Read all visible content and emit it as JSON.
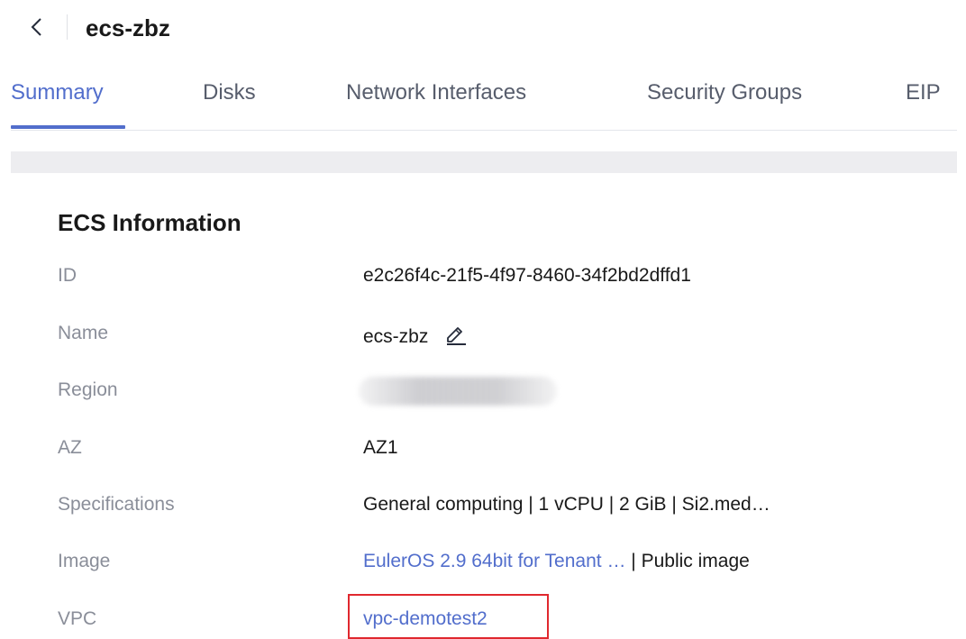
{
  "header": {
    "title": "ecs-zbz"
  },
  "tabs": [
    {
      "label": "Summary",
      "active": true
    },
    {
      "label": "Disks",
      "active": false
    },
    {
      "label": "Network Interfaces",
      "active": false
    },
    {
      "label": "Security Groups",
      "active": false
    },
    {
      "label": "EIP",
      "active": false
    }
  ],
  "section": {
    "title": "ECS Information"
  },
  "info": {
    "id": {
      "label": "ID",
      "value": "e2c26f4c-21f5-4f97-8460-34f2bd2dffd1"
    },
    "name": {
      "label": "Name",
      "value": "ecs-zbz"
    },
    "region": {
      "label": "Region",
      "value_redacted": true
    },
    "az": {
      "label": "AZ",
      "value": "AZ1"
    },
    "specifications": {
      "label": "Specifications",
      "value": "General computing | 1 vCPU | 2 GiB | Si2.med…"
    },
    "image": {
      "label": "Image",
      "link": "EulerOS 2.9 64bit for Tenant …",
      "suffix": " | Public image"
    },
    "vpc": {
      "label": "VPC",
      "link": "vpc-demotest2"
    }
  },
  "colors": {
    "accent": "#526ecc",
    "highlight": "#e0282e",
    "label": "#8a8e99"
  },
  "icons": {
    "back": "chevron-left-icon",
    "edit": "pencil-icon"
  }
}
